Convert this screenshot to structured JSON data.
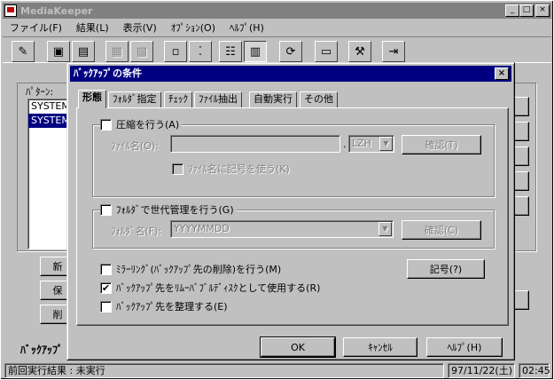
{
  "app": {
    "title": "MediaKeeper"
  },
  "menu": [
    {
      "label": "ファイル(F)"
    },
    {
      "label": "結果(L)"
    },
    {
      "label": "表示(V)"
    },
    {
      "label": "ｵﾌﾟｼｮﾝ(O)"
    },
    {
      "label": "ﾍﾙﾌﾟ(H)"
    }
  ],
  "pattern": {
    "label": "ﾊﾟﾀｰﾝ:",
    "items": [
      "SYSTEM",
      "SYSTEM"
    ]
  },
  "side_buttons": [
    "新",
    "保",
    "削"
  ],
  "backup_section_label": "ﾊﾞｯｸｱｯﾌﾟ",
  "status": {
    "last_result": "前回実行結果 : 未実行",
    "date": "97/11/22(土)",
    "time": "02:45"
  },
  "dialog": {
    "title": "ﾊﾞｯｸｱｯﾌﾟの条件",
    "close_label": "×",
    "tabs": [
      "形態",
      "ﾌｫﾙﾀﾞ指定",
      "ﾁｪｯｸ",
      "ﾌｧｲﾙ抽出",
      "自動実行",
      "その他"
    ],
    "compress": {
      "label": "圧縮を行う(A)",
      "checked": false,
      "filename_label": "ﾌｧｲﾙ名(O):",
      "filename_value": "",
      "ext_value": "LZH",
      "confirm_label": "確認(T)",
      "symbol_label": "ﾌｧｲﾙ名に記号を使う(K)"
    },
    "generation": {
      "label": "ﾌｫﾙﾀﾞで世代管理を行う(G)",
      "checked": false,
      "folder_label": "ﾌｫﾙﾀﾞ名(F):",
      "folder_value": "YYYYMMDD",
      "confirm_label": "確認(C)"
    },
    "mirroring": {
      "label": "ﾐﾗｰﾘﾝｸﾞ(ﾊﾞｯｸｱｯﾌﾟ先の削除)を行う(M)",
      "checked": false
    },
    "symbol_button": "記号(?)",
    "removable": {
      "label": "ﾊﾞｯｸｱｯﾌﾟ先をﾘﾑｰﾊﾞﾌﾞﾙﾃﾞｨｽｸとして使用する(R)",
      "checked": true
    },
    "organize": {
      "label": "ﾊﾞｯｸｱｯﾌﾟ先を整理する(E)",
      "checked": false
    },
    "ok": "OK",
    "cancel": "ｷｬﾝｾﾙ",
    "help": "ﾍﾙﾌﾟ(H)"
  }
}
